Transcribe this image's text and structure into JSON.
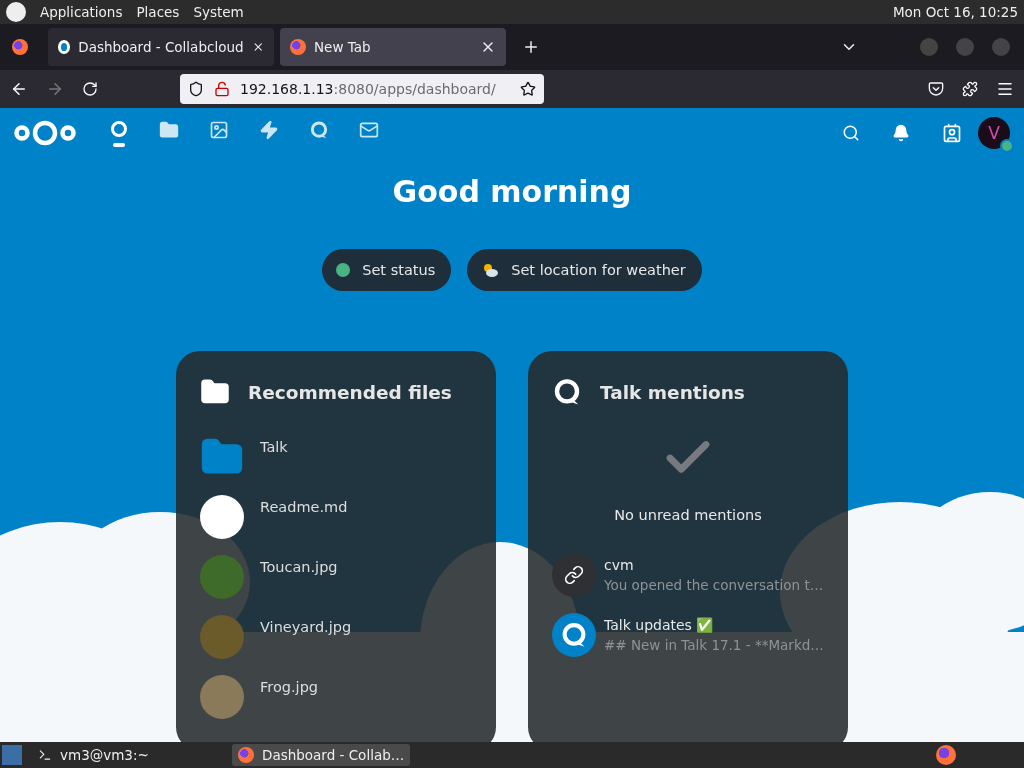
{
  "top_panel": {
    "menus": [
      "Applications",
      "Places",
      "System"
    ],
    "clock": "Mon Oct 16, 10:25"
  },
  "browser": {
    "tabs": [
      {
        "title": "Dashboard - Collabcloud",
        "kind": "cloud",
        "selected": false
      },
      {
        "title": "New Tab",
        "kind": "firefox",
        "selected": true
      }
    ],
    "url_host": "192.168.1.13",
    "url_rest": ":8080/apps/dashboard/"
  },
  "header": {
    "apps": [
      {
        "kind": "dashboard",
        "selected": true
      },
      {
        "kind": "files",
        "selected": false
      },
      {
        "kind": "photos",
        "selected": false
      },
      {
        "kind": "activity",
        "selected": false
      },
      {
        "kind": "talk",
        "selected": false
      },
      {
        "kind": "mail",
        "selected": false
      }
    ],
    "avatar": "V"
  },
  "greeting": "Good morning",
  "status_buttons": [
    {
      "kind": "status",
      "label": "Set status"
    },
    {
      "kind": "weather",
      "label": "Set location for weather"
    }
  ],
  "widgets": [
    {
      "kind": "files",
      "title": "Recommended files",
      "items": [
        {
          "kind": "folder",
          "name": "Talk"
        },
        {
          "kind": "blank",
          "name": "Readme.md"
        },
        {
          "kind": "photo",
          "name": "Toucan.jpg",
          "color": "#3e6b2a"
        },
        {
          "kind": "photo",
          "name": "Vineyard.jpg",
          "color": "#6b5a2a"
        },
        {
          "kind": "photo",
          "name": "Frog.jpg",
          "color": "#8a7a5a"
        }
      ]
    },
    {
      "kind": "talk",
      "title": "Talk mentions",
      "empty": "No unread mentions",
      "items": [
        {
          "kind": "link",
          "name": "cvm",
          "preview": "You opened the conversation t…"
        },
        {
          "kind": "talk",
          "name": "Talk updates ✅",
          "preview": "## New in Talk 17.1 - **Markd…"
        }
      ]
    }
  ],
  "taskbar": {
    "items": [
      {
        "kind": "terminal",
        "label": "vm3@vm3:~",
        "selected": false
      },
      {
        "kind": "firefox",
        "label": "Dashboard - Collab…",
        "selected": true
      }
    ]
  }
}
